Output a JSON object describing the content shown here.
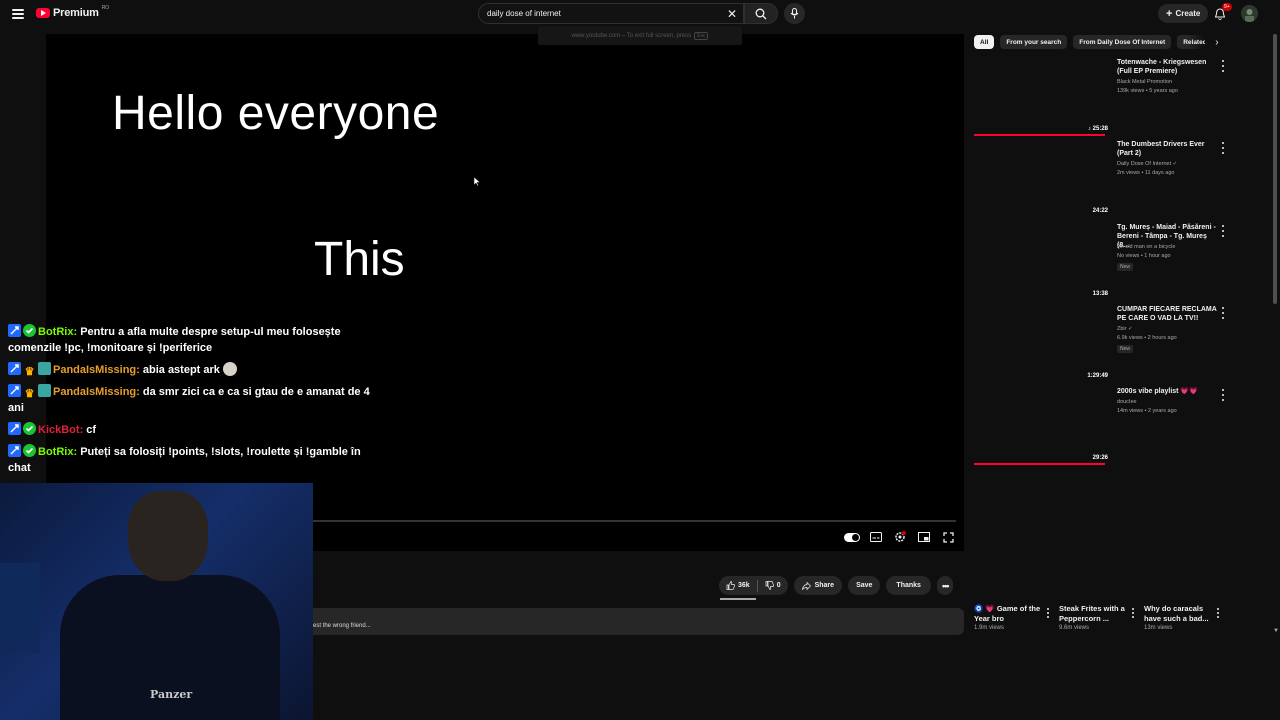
{
  "header": {
    "logo_text": "Premium",
    "logo_region": "RO",
    "search_value": "daily dose of internet",
    "create_label": "Create",
    "notifications_badge": "9+"
  },
  "fullscreen_notice": {
    "text": "www.youtube.com – To exit full screen, press",
    "key": "Esc"
  },
  "player": {
    "caption_line1": "Hello everyone",
    "caption_line2": "This"
  },
  "chat": [
    {
      "badges": [
        "pin",
        "verify"
      ],
      "user": "BotRix",
      "user_class": "botrix",
      "text": "Pentru a afla multe despre setup-ul meu folosește comenzile !pc, !monitoare și !periferice",
      "emote": false
    },
    {
      "badges": [
        "pin",
        "crown",
        "grid"
      ],
      "user": "PandaIsMissing",
      "user_class": "pandals",
      "text": "abia astept ark",
      "emote": true
    },
    {
      "badges": [
        "pin",
        "crown",
        "grid"
      ],
      "user": "PandaIsMissing",
      "user_class": "pandals",
      "text": "da smr zici ca e ca si gtau de e amanat de 4 ani",
      "emote": false
    },
    {
      "badges": [
        "pin",
        "verify"
      ],
      "user": "KickBot",
      "user_class": "kick",
      "text": "cf",
      "emote": false
    },
    {
      "badges": [
        "pin",
        "verify"
      ],
      "user": "BotRix",
      "user_class": "botrix",
      "text": "Puteți sa folosiți !points, !slots, !roulette și !gamble în chat",
      "emote": false
    }
  ],
  "webcam": {
    "shirt_text": "Panzer"
  },
  "actions": {
    "likes": "36k",
    "dislikes": "0",
    "share": "Share",
    "save": "Save",
    "thanks": "Thanks"
  },
  "description_snippet": "est the wrong friend...",
  "chips": [
    "All",
    "From your search",
    "From Daily Dose Of Internet",
    "Related"
  ],
  "recommendations": [
    {
      "title": "Totenwache - Kriegswesen (Full EP Premiere)",
      "channel": "Black Metal Promotion",
      "meta": "139k views • 5 years ago",
      "duration": "25:28",
      "duration_icon": "♪",
      "watched": 0.95,
      "new": false,
      "verified": false
    },
    {
      "title": "The Dumbest Drivers Ever (Part 2)",
      "channel": "Daily Dose Of Internet",
      "meta": "2m views • 11 days ago",
      "duration": "24:22",
      "duration_icon": "",
      "watched": 0,
      "new": false,
      "verified": true
    },
    {
      "title": "Tg. Mureș - Maiad - Păsăreni - Bereni - Tâmpa - Tg. Mureș (8...",
      "channel": "An old man on a bicycle",
      "meta": "No views • 1 hour ago",
      "duration": "13:38",
      "duration_icon": "",
      "watched": 0,
      "new": true,
      "verified": false
    },
    {
      "title": "CUMPAR FIECARE RECLAMA PE CARE O VAD LA TV!!",
      "channel": "Zbir",
      "meta": "6.9k views • 2 hours ago",
      "duration": "1:29:49",
      "duration_icon": "",
      "watched": 0,
      "new": true,
      "verified": true
    },
    {
      "title": "2000s vibe playlist 💗💗",
      "channel": "doucIee",
      "meta": "14m views • 2 years ago",
      "duration": "29:26",
      "duration_icon": "",
      "watched": 0.95,
      "new": false,
      "verified": false
    }
  ],
  "shorts": [
    {
      "title": "🧿 💗 Game of the Year bro",
      "views": "1.9m views"
    },
    {
      "title": "Steak Frites with a Peppercorn ...",
      "views": "9.6m views"
    },
    {
      "title": "Why do caracals have such a bad...",
      "views": "13m views"
    }
  ],
  "colors": {
    "background": "#0f0f0f",
    "accent": "#ff0033",
    "botrix": "#7cfc00",
    "pandals": "#e6a02a",
    "kick": "#e0203c"
  }
}
